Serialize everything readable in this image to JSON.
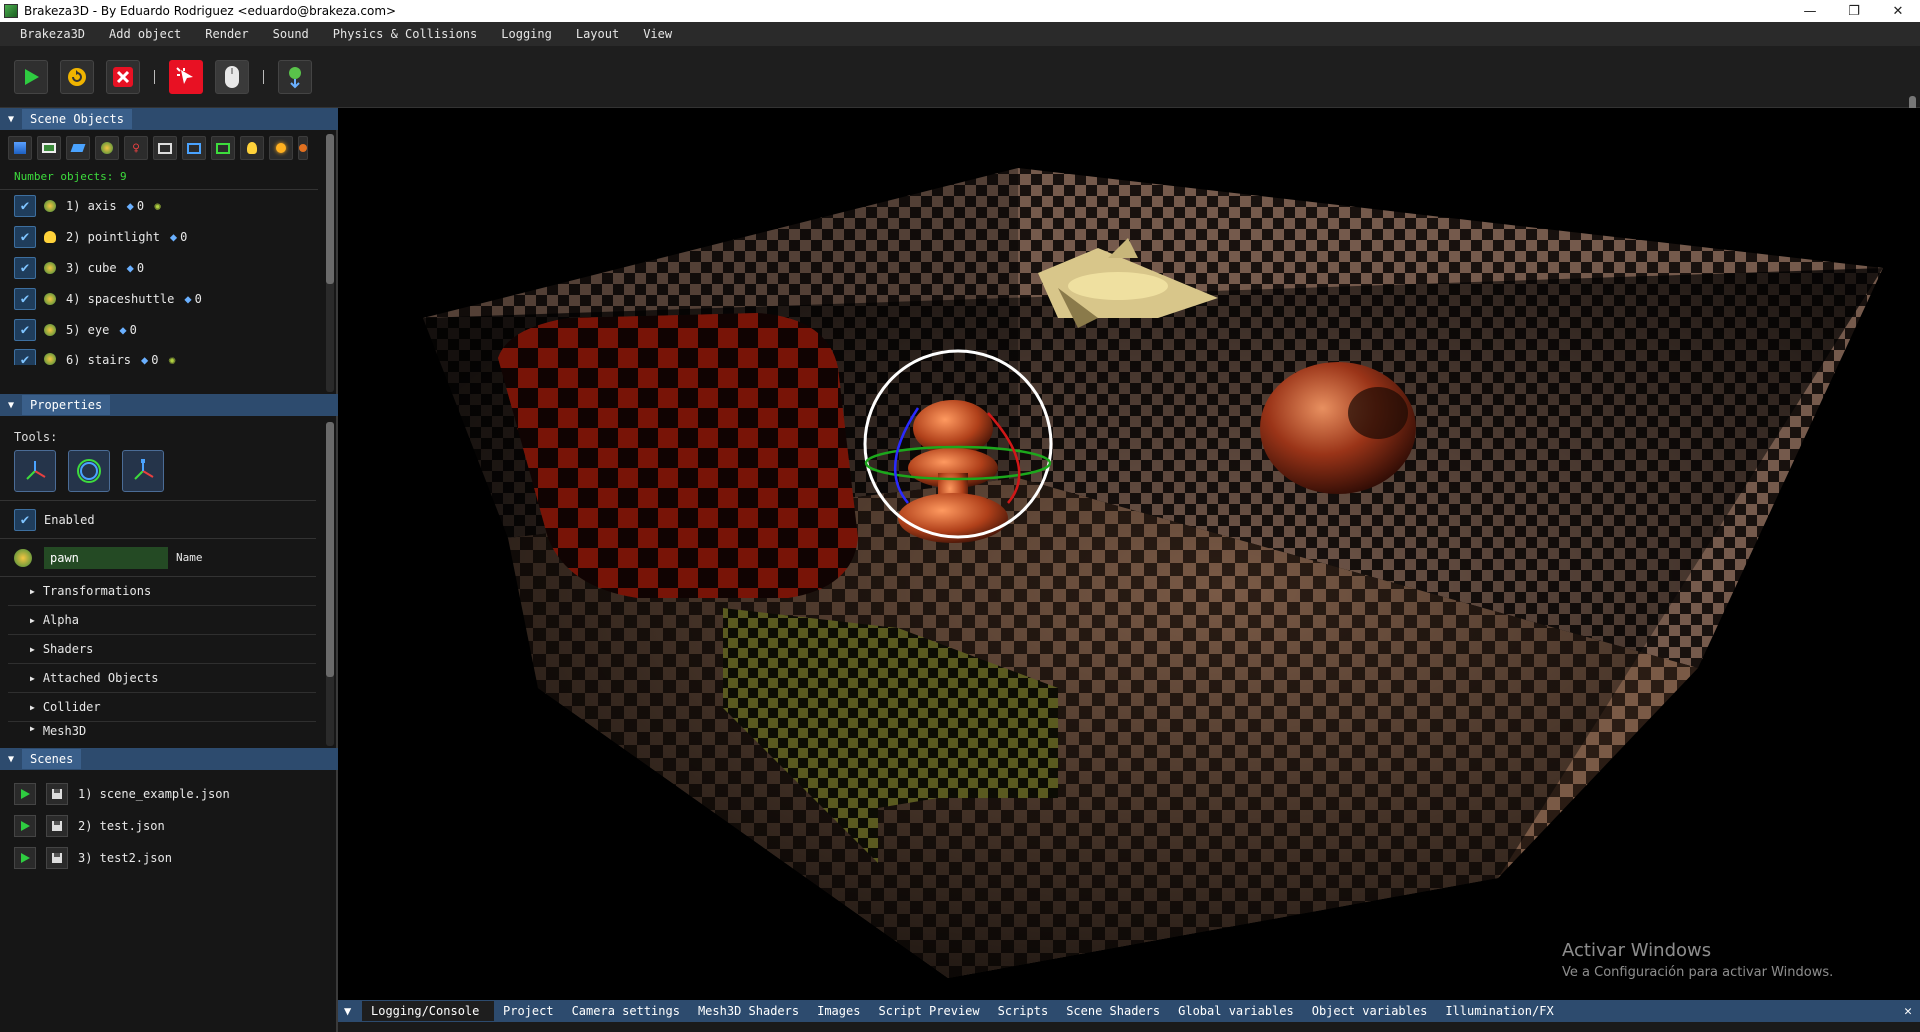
{
  "window": {
    "title": "Brakeza3D - By Eduardo Rodriguez <eduardo@brakeza.com>",
    "controls": [
      "—",
      "❐",
      "✕"
    ]
  },
  "menu": [
    "Brakeza3D",
    "Add object",
    "Render",
    "Sound",
    "Physics & Collisions",
    "Logging",
    "Layout",
    "View"
  ],
  "toolbar": {
    "icons": [
      "play-icon",
      "reload-icon",
      "stop-icon",
      "cursor-icon",
      "mouse-icon",
      "pin-icon"
    ],
    "colors": {
      "play": "#2ecc40",
      "reload": "#f0b400",
      "stop": "#e81123",
      "cursor": "#e81123"
    }
  },
  "scene_objects": {
    "tab": "Scene Objects",
    "count_label": "Number objects: 9",
    "items": [
      {
        "label": "1) axis",
        "badge": "0"
      },
      {
        "label": "2) pointlight",
        "badge": "0"
      },
      {
        "label": "3) cube",
        "badge": "0"
      },
      {
        "label": "4) spaceshuttle",
        "badge": "0"
      },
      {
        "label": "5) eye",
        "badge": "0"
      },
      {
        "label": "6) stairs",
        "badge": "0"
      }
    ]
  },
  "properties": {
    "tab": "Properties",
    "tools_label": "Tools:",
    "enabled_label": "Enabled",
    "name_value": "pawn",
    "name_label": "Name",
    "sections": [
      "Transformations",
      "Alpha",
      "Shaders",
      "Attached Objects",
      "Collider",
      "Mesh3D"
    ]
  },
  "scenes": {
    "tab": "Scenes",
    "items": [
      "1) scene_example.json",
      "2) test.json",
      "3) test2.json"
    ]
  },
  "bottom_tabs": {
    "active": "Logging/Console",
    "items": [
      "Project",
      "Camera settings",
      "Mesh3D Shaders",
      "Images",
      "Script Preview",
      "Scripts",
      "Scene Shaders",
      "Global variables",
      "Object variables",
      "Illumination/FX"
    ]
  },
  "watermark": {
    "line1": "Activar Windows",
    "line2": "Ve a Configuración para activar Windows."
  }
}
